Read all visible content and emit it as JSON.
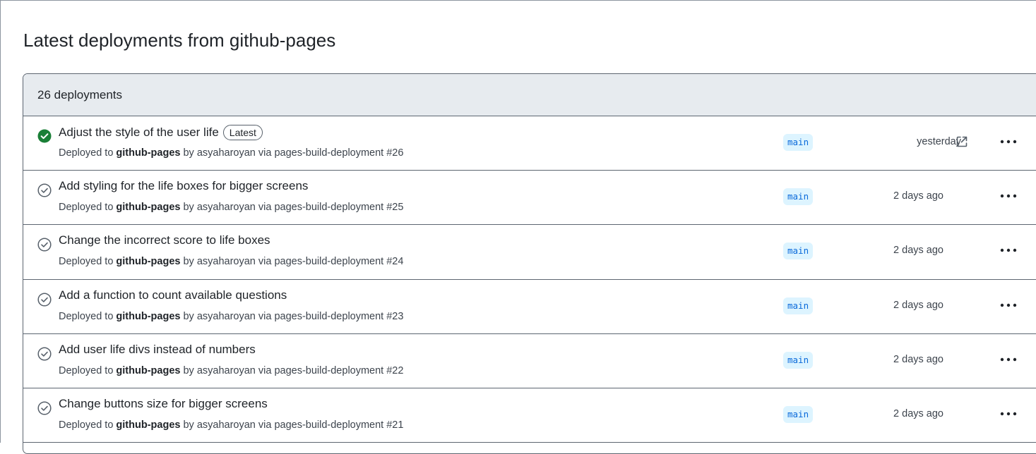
{
  "page": {
    "title": "Latest deployments from github-pages"
  },
  "list": {
    "count_label": "26 deployments",
    "latest_badge": "Latest",
    "colors": {
      "success": "#1a7f37",
      "neutral": "#57606a",
      "branch_bg": "#ddf4ff",
      "branch_fg": "#0969da",
      "header_bg": "#e7ebef"
    },
    "rows": [
      {
        "title": "Adjust the style of the user life",
        "deployed_prefix": "Deployed to",
        "environment": "github-pages",
        "by_text": "by asyaharoyan via pages-build-deployment #26",
        "branch": "main",
        "time": "yesterday",
        "status_icon": "check-circle-fill-icon"
      },
      {
        "title": "Add styling for the life boxes for bigger screens",
        "deployed_prefix": "Deployed to",
        "environment": "github-pages",
        "by_text": "by asyaharoyan via pages-build-deployment #25",
        "branch": "main",
        "time": "2 days ago",
        "status_icon": "check-circle-icon"
      },
      {
        "title": "Change the incorrect score to life boxes",
        "deployed_prefix": "Deployed to",
        "environment": "github-pages",
        "by_text": "by asyaharoyan via pages-build-deployment #24",
        "branch": "main",
        "time": "2 days ago",
        "status_icon": "check-circle-icon"
      },
      {
        "title": "Add a function to count available questions",
        "deployed_prefix": "Deployed to",
        "environment": "github-pages",
        "by_text": "by asyaharoyan via pages-build-deployment #23",
        "branch": "main",
        "time": "2 days ago",
        "status_icon": "check-circle-icon"
      },
      {
        "title": "Add user life divs instead of numbers",
        "deployed_prefix": "Deployed to",
        "environment": "github-pages",
        "by_text": "by asyaharoyan via pages-build-deployment #22",
        "branch": "main",
        "time": "2 days ago",
        "status_icon": "check-circle-icon"
      },
      {
        "title": "Change buttons size for bigger screens",
        "deployed_prefix": "Deployed to",
        "environment": "github-pages",
        "by_text": "by asyaharoyan via pages-build-deployment #21",
        "branch": "main",
        "time": "2 days ago",
        "status_icon": "check-circle-icon"
      }
    ]
  }
}
